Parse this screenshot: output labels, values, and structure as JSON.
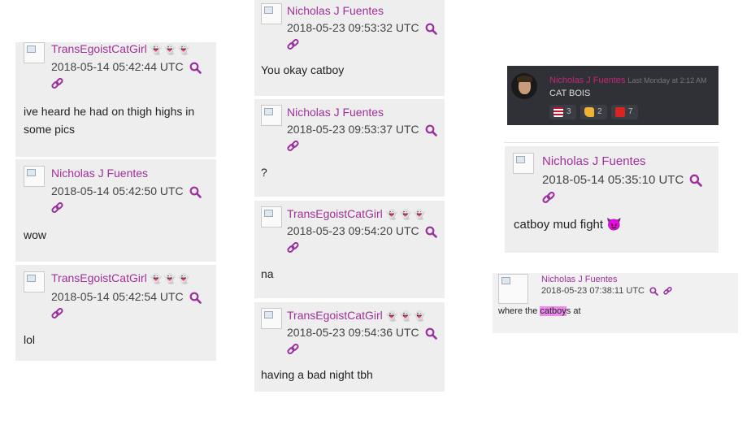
{
  "colors": {
    "username": "#a0309a",
    "card_bg": "#eeeeee",
    "discord_bg": "#2f3136",
    "highlight": "#ee88ee"
  },
  "icons": {
    "search": "search-icon",
    "link": "link-icon",
    "ghost": "ghost-emoji",
    "devil": "devil-emoji"
  },
  "column1": [
    {
      "user": "TransEgoistCatGirl",
      "ghosts": "👻👻👻",
      "timestamp": "2018-05-14 05:42:44 UTC",
      "message_line1": "ive heard he had on thigh highs in",
      "message_line2": "some pics"
    },
    {
      "user": "Nicholas J Fuentes",
      "timestamp": "2018-05-14 05:42:50 UTC",
      "message": "wow"
    },
    {
      "user": "TransEgoistCatGirl",
      "ghosts": "👻👻👻",
      "timestamp": "2018-05-14 05:42:54 UTC",
      "message": "lol"
    }
  ],
  "column2": [
    {
      "user": "Nicholas J Fuentes",
      "timestamp": "2018-05-23 09:53:32 UTC",
      "message": "You okay catboy"
    },
    {
      "user": "Nicholas J Fuentes",
      "timestamp": "2018-05-23 09:53:37 UTC",
      "message": "?"
    },
    {
      "user": "TransEgoistCatGirl",
      "ghosts": "👻👻👻",
      "timestamp": "2018-05-23 09:54:20 UTC",
      "message": "na"
    },
    {
      "user": "TransEgoistCatGirl",
      "ghosts": "👻👻👻",
      "timestamp": "2018-05-23 09:54:36 UTC",
      "message": "having a bad night tbh"
    }
  ],
  "discord": {
    "user": "Nicholas J Fuentes",
    "time": "Last Monday at 2:12 AM",
    "message": "CAT BOIS",
    "reactions": [
      {
        "emoji": "flag-icon",
        "color": "#c8102e",
        "count": "3"
      },
      {
        "emoji": "thumbs-up-icon",
        "color": "#f0b232",
        "count": "2"
      },
      {
        "emoji": "red-square-icon",
        "color": "#dd2222",
        "count": "7"
      }
    ]
  },
  "column3_post": {
    "user": "Nicholas J Fuentes",
    "timestamp": "2018-05-14 05:35:10 UTC",
    "message": "catboy mud fight",
    "emoji": "😈"
  },
  "small_post": {
    "user": "Nicholas J Fuentes",
    "timestamp": "2018-05-23 07:38:11 UTC",
    "message_pre": "where the ",
    "message_highlight": "catboy",
    "message_post": "s at"
  }
}
